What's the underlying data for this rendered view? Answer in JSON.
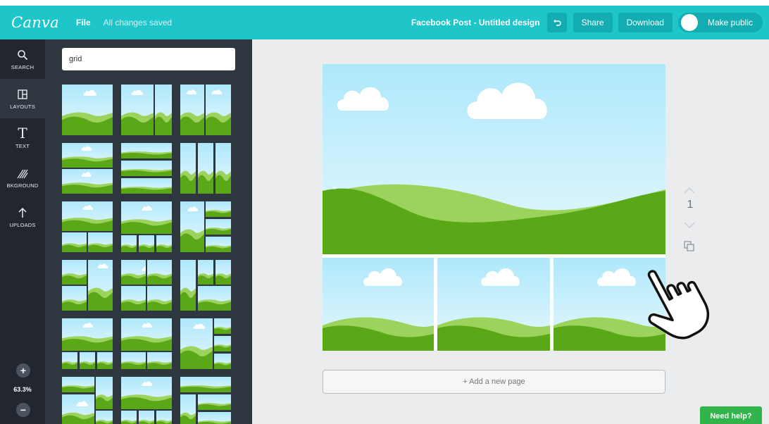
{
  "app": {
    "logo": "Canva",
    "file_menu": "File",
    "save_status": "All changes saved",
    "doc_title": "Facebook Post - Untitled design",
    "undo_icon": "undo-icon",
    "buttons": {
      "share": "Share",
      "download": "Download",
      "make_public": "Make public"
    },
    "colors": {
      "topbar": "#1ec5c9",
      "button": "#11adb1",
      "rail": "#22272f",
      "panel": "#2e3640",
      "sky": "#bfeefb",
      "grass": "#5aa718",
      "grass_light": "#9bd35c",
      "need_help": "#31b44b"
    }
  },
  "rail": {
    "items": [
      {
        "label": "SEARCH",
        "icon": "search-icon"
      },
      {
        "label": "LAYOUTS",
        "icon": "layouts-icon"
      },
      {
        "label": "TEXT",
        "icon": "text-icon"
      },
      {
        "label": "BKGROUND",
        "icon": "background-icon"
      },
      {
        "label": "UPLOADS",
        "icon": "upload-icon"
      }
    ],
    "zoom_in": "+",
    "zoom_level": "63.3%",
    "zoom_out": "−"
  },
  "search": {
    "value": "grid",
    "placeholder": ""
  },
  "canvas": {
    "page_number": "1",
    "add_page": "+ Add a new page",
    "need_help": "Need help?",
    "page_up_icon": "chevron-up-icon",
    "page_down_icon": "chevron-down-icon",
    "copy_icon": "copy-page-icon",
    "cursor_icon": "hand-pointer-icon"
  }
}
